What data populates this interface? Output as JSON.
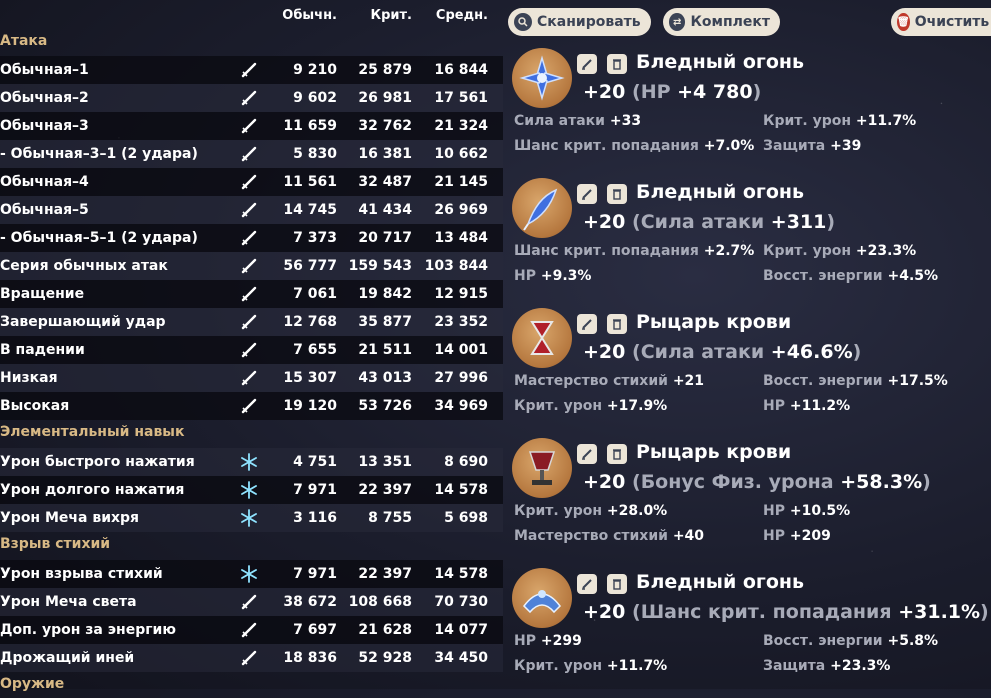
{
  "table": {
    "headers": [
      "Обычн.",
      "Крит.",
      "Средн."
    ],
    "sections": {
      "attack": "Атака",
      "skill": "Элементальный навык",
      "burst": "Взрыв стихий",
      "weapon": "Оружие"
    },
    "rows": [
      {
        "name": "Обычная–1",
        "icon": "sword-icon",
        "n": "9 210",
        "c": "25 879",
        "a": "16 844"
      },
      {
        "name": "Обычная–2",
        "icon": "sword-icon",
        "n": "9 602",
        "c": "26 981",
        "a": "17 561"
      },
      {
        "name": "Обычная–3",
        "icon": "sword-icon",
        "n": "11 659",
        "c": "32 762",
        "a": "21 324"
      },
      {
        "name": "- Обычная–3–1 (2 удара)",
        "icon": "sword-icon",
        "n": "5 830",
        "c": "16 381",
        "a": "10 662"
      },
      {
        "name": "Обычная–4",
        "icon": "sword-icon",
        "n": "11 561",
        "c": "32 487",
        "a": "21 145"
      },
      {
        "name": "Обычная–5",
        "icon": "sword-icon",
        "n": "14 745",
        "c": "41 434",
        "a": "26 969"
      },
      {
        "name": "- Обычная–5–1 (2 удара)",
        "icon": "sword-icon",
        "n": "7 373",
        "c": "20 717",
        "a": "13 484"
      },
      {
        "name": "Серия обычных атак",
        "icon": "sword-icon",
        "n": "56 777",
        "c": "159 543",
        "a": "103 844"
      },
      {
        "name": "Вращение",
        "icon": "sword-icon",
        "n": "7 061",
        "c": "19 842",
        "a": "12 915"
      },
      {
        "name": "Завершающий удар",
        "icon": "sword-icon",
        "n": "12 768",
        "c": "35 877",
        "a": "23 352"
      },
      {
        "name": "В падении",
        "icon": "sword-icon",
        "n": "7 655",
        "c": "21 511",
        "a": "14 001"
      },
      {
        "name": "Низкая",
        "icon": "sword-icon",
        "n": "15 307",
        "c": "43 013",
        "a": "27 996"
      },
      {
        "name": "Высокая",
        "icon": "sword-icon",
        "n": "19 120",
        "c": "53 726",
        "a": "34 969"
      },
      {
        "name": "Урон быстрого нажатия",
        "icon": "cryo-icon",
        "n": "4 751",
        "c": "13 351",
        "a": "8 690"
      },
      {
        "name": "Урон долгого нажатия",
        "icon": "cryo-icon",
        "n": "7 971",
        "c": "22 397",
        "a": "14 578"
      },
      {
        "name": "Урон Меча вихря",
        "icon": "cryo-icon",
        "n": "3 116",
        "c": "8 755",
        "a": "5 698"
      },
      {
        "name": "Урон взрыва стихий",
        "icon": "cryo-icon",
        "n": "7 971",
        "c": "22 397",
        "a": "14 578"
      },
      {
        "name": "Урон Меча света",
        "icon": "sword-icon",
        "n": "38 672",
        "c": "108 668",
        "a": "70 730"
      },
      {
        "name": "Доп. урон за энергию",
        "icon": "sword-icon",
        "n": "7 697",
        "c": "21 628",
        "a": "14 077"
      },
      {
        "name": "Дрожащий иней",
        "icon": "sword-icon",
        "n": "18 836",
        "c": "52 928",
        "a": "34 450"
      }
    ]
  },
  "toolbar": {
    "scan_label": "Сканировать",
    "set_label": "Комплект",
    "clear_label": "Очистить"
  },
  "artifacts": [
    {
      "set": "Бледный огонь",
      "level": "+20",
      "main_stat": "HP",
      "main_val": "+4 780",
      "icon": "flower-icon",
      "subs": [
        [
          "Сила атаки",
          "+33"
        ],
        [
          "Крит. урон",
          "+11.7%"
        ],
        [
          "Шанс крит. попадания",
          "+7.0%"
        ],
        [
          "Защита",
          "+39"
        ]
      ]
    },
    {
      "set": "Бледный огонь",
      "level": "+20",
      "main_stat": "Сила атаки",
      "main_val": "+311",
      "icon": "feather-icon",
      "subs": [
        [
          "Шанс крит. попадания",
          "+2.7%"
        ],
        [
          "Крит. урон",
          "+23.3%"
        ],
        [
          "HP",
          "+9.3%"
        ],
        [
          "Восст. энергии",
          "+4.5%"
        ]
      ]
    },
    {
      "set": "Рыцарь крови",
      "level": "+20",
      "main_stat": "Сила атаки",
      "main_val": "+46.6%",
      "icon": "hourglass-icon",
      "subs": [
        [
          "Мастерство стихий",
          "+21"
        ],
        [
          "Восст. энергии",
          "+17.5%"
        ],
        [
          "Крит. урон",
          "+17.9%"
        ],
        [
          "HP",
          "+11.2%"
        ]
      ]
    },
    {
      "set": "Рыцарь крови",
      "level": "+20",
      "main_stat": "Бонус Физ. урона",
      "main_val": "+58.3%",
      "icon": "goblet-icon",
      "subs": [
        [
          "Крит. урон",
          "+28.0%"
        ],
        [
          "HP",
          "+10.5%"
        ],
        [
          "Мастерство стихий",
          "+40"
        ],
        [
          "HP",
          "+209"
        ]
      ]
    },
    {
      "set": "Бледный огонь",
      "level": "+20",
      "main_stat": "Шанс крит. попадания",
      "main_val": "+31.1%",
      "icon": "circlet-icon",
      "subs": [
        [
          "HP",
          "+299"
        ],
        [
          "Восст. энергии",
          "+5.8%"
        ],
        [
          "Крит. урон",
          "+11.7%"
        ],
        [
          "Защита",
          "+23.3%"
        ]
      ]
    }
  ],
  "colors": {
    "section": "#d8b985",
    "button_bg": "#ece5d8",
    "button_fg": "#3b4355",
    "artifact_bg": "#b5773e"
  }
}
